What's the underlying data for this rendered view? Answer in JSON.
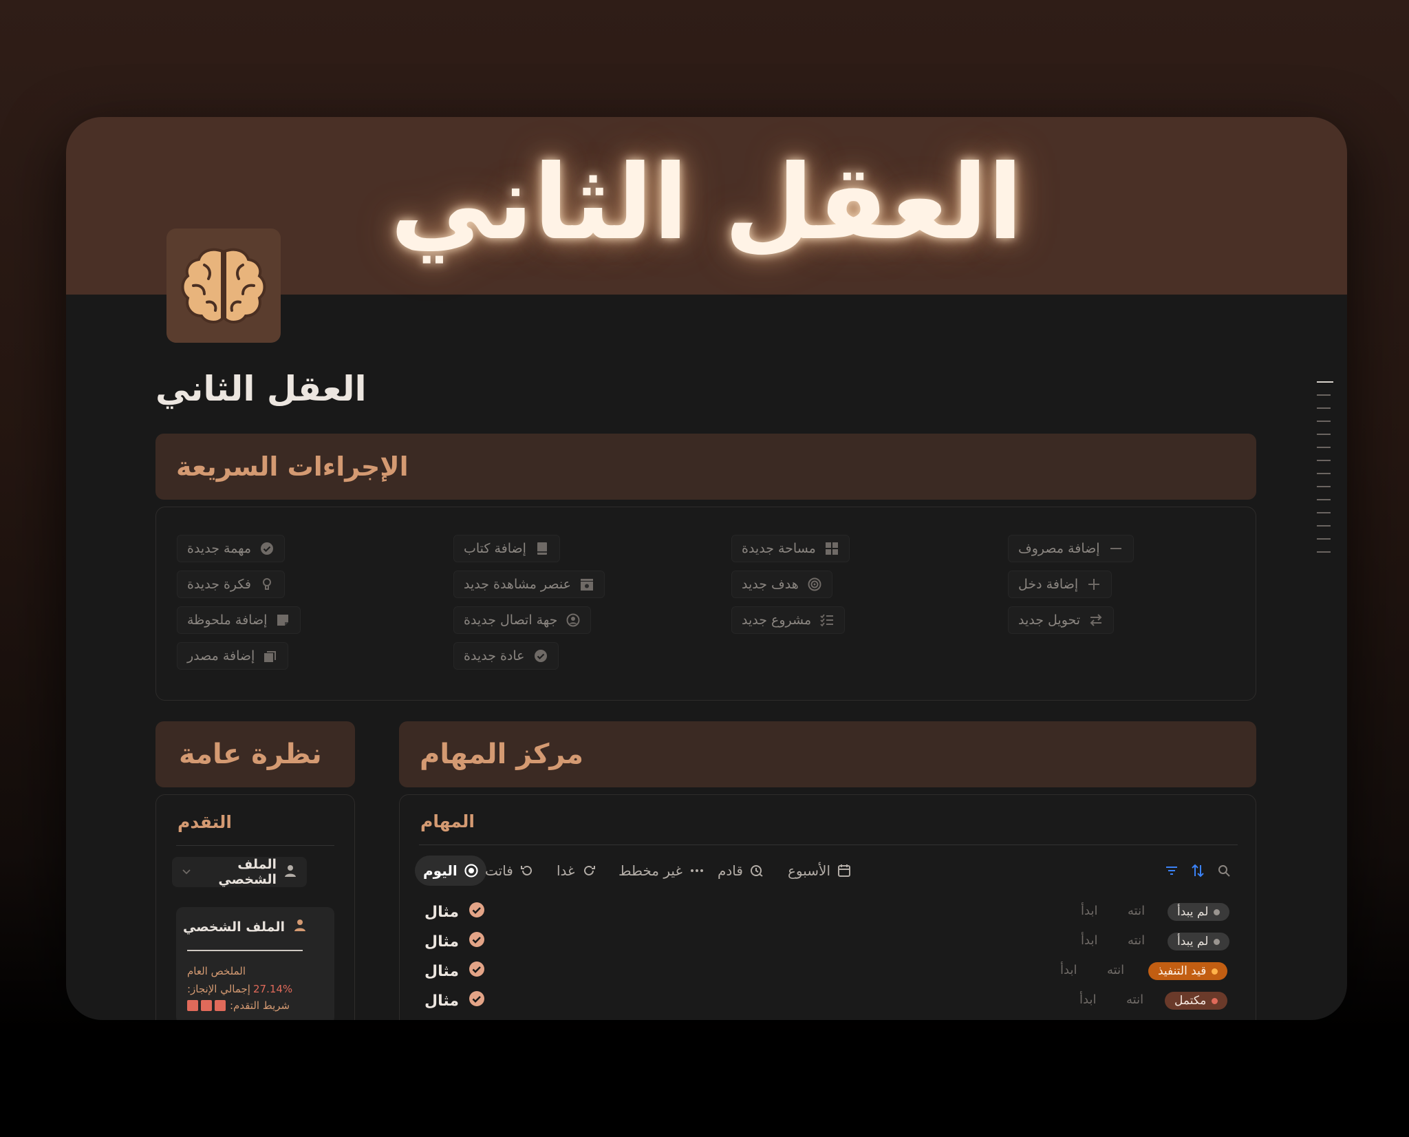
{
  "banner": {
    "title": "العقل الثاني"
  },
  "page": {
    "title": "العقل الثاني",
    "icon": "brain-icon"
  },
  "quick_actions": {
    "title": "الإجراءات السريعة",
    "items": [
      {
        "label": "مهمة جديدة",
        "icon": "check-circle-icon"
      },
      {
        "label": "فكرة جديدة",
        "icon": "lightbulb-icon"
      },
      {
        "label": "إضافة ملحوظة",
        "icon": "note-icon"
      },
      {
        "label": "إضافة مصدر",
        "icon": "stack-icon"
      },
      {
        "label": "إضافة كتاب",
        "icon": "book-icon"
      },
      {
        "label": "عنصر مشاهدة جديد",
        "icon": "clapperboard-icon"
      },
      {
        "label": "جهة اتصال جديدة",
        "icon": "contact-icon"
      },
      {
        "label": "عادة جديدة",
        "icon": "check-badge-icon"
      },
      {
        "label": "مساحة جديدة",
        "icon": "grid-icon"
      },
      {
        "label": "هدف جديد",
        "icon": "target-icon"
      },
      {
        "label": "مشروع جديد",
        "icon": "checklist-icon"
      },
      {
        "label": "إضافة مصروف",
        "icon": "minus-icon"
      },
      {
        "label": "إضافة دخل",
        "icon": "plus-icon"
      },
      {
        "label": "تحويل جديد",
        "icon": "swap-icon"
      }
    ]
  },
  "overview": {
    "title": "نظرة عامة",
    "progress_label": "التقدم",
    "profile_button": "الملف الشخصي",
    "card": {
      "title": "الملف الشخصي",
      "summary_label": "الملخص العام",
      "completion_label": "إجمالي الإنجاز:",
      "completion_value": "27.14%",
      "progress_bar_label": "شريط التقدم:"
    }
  },
  "tasks": {
    "title": "مركز المهام",
    "list_label": "المهام",
    "tabs": [
      {
        "label": "اليوم",
        "icon": "record-icon",
        "active": true
      },
      {
        "label": "فاتت",
        "icon": "history-icon",
        "active": false
      },
      {
        "label": "غدا",
        "icon": "redo-icon",
        "active": false
      },
      {
        "label": "غير مخطط",
        "icon": "dots-icon",
        "active": false
      },
      {
        "label": "قادم",
        "icon": "clock-arrow-icon",
        "active": false
      },
      {
        "label": "الأسبوع",
        "icon": "calendar-icon",
        "active": false
      }
    ],
    "rows": [
      {
        "name": "مثال",
        "start": "ابدأ",
        "done": "انته",
        "status": "لم يبدأ"
      },
      {
        "name": "مثال",
        "start": "ابدأ",
        "done": "انته",
        "status": "لم يبدأ"
      },
      {
        "name": "مثال",
        "start": "ابدأ",
        "done": "انته",
        "status": "قيد التنفيذ"
      },
      {
        "name": "مثال",
        "start": "ابدأ",
        "done": "انته",
        "status": "مكتمل"
      }
    ],
    "status_colors": {
      "not_started": "#3a3a3a",
      "in_progress": "#c25e12",
      "complete": "#6a3a2a"
    }
  },
  "colors": {
    "accent": "#d49a72",
    "header_bg": "#3b2a23",
    "banner_bg": "#4a3026"
  }
}
